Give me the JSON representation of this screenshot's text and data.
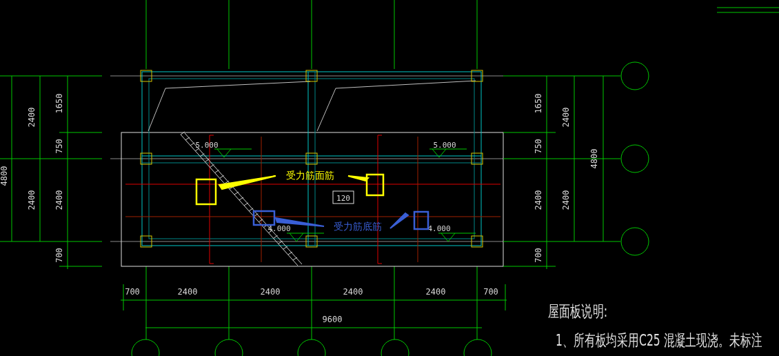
{
  "drawing": {
    "left_dimensions": {
      "total": "4800",
      "column_1": [
        "2400",
        "2400"
      ],
      "column_2": [
        "1650",
        "750",
        "2400",
        "700"
      ]
    },
    "right_dimensions": {
      "column_1": [
        "1650",
        "750",
        "2400",
        "700"
      ],
      "column_2": [
        "2400",
        "2400"
      ],
      "total": "4800"
    },
    "bottom_dimensions": {
      "segments": [
        "700",
        "2400",
        "2400",
        "2400",
        "2400",
        "700"
      ],
      "total": "9600"
    },
    "elevations": [
      "5.000",
      "5.000",
      "4.000",
      "4.000"
    ],
    "slab_thickness": "120",
    "annotations": [
      {
        "text": "受力筋面筋",
        "color": "#ffff00"
      },
      {
        "text": "受力筋底筋",
        "color": "#3a5fd6"
      }
    ],
    "notes": {
      "title": "屋面板说明:",
      "lines": [
        "1、所有板均采用C25 混凝土现浇。未标注"
      ]
    }
  }
}
